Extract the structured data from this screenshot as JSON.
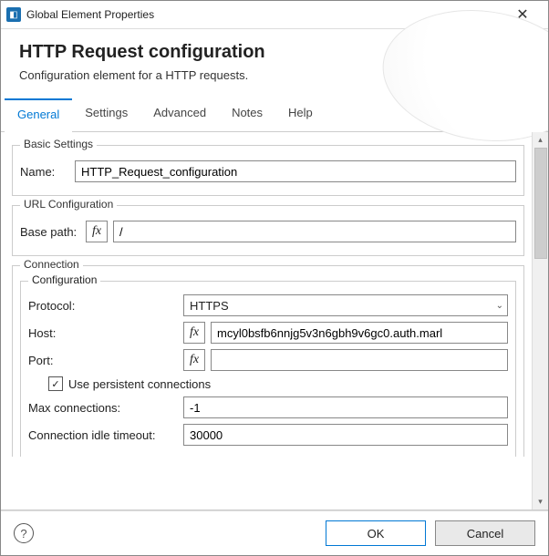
{
  "window": {
    "title": "Global Element Properties"
  },
  "header": {
    "title": "HTTP Request configuration",
    "desc": "Configuration element for a HTTP requests."
  },
  "tabs": {
    "general": "General",
    "settings": "Settings",
    "advanced": "Advanced",
    "notes": "Notes",
    "help": "Help"
  },
  "groups": {
    "basic": "Basic Settings",
    "url": "URL Configuration",
    "connection": "Connection",
    "config": "Configuration"
  },
  "labels": {
    "name": "Name:",
    "basepath": "Base path:",
    "protocol": "Protocol:",
    "host": "Host:",
    "port": "Port:",
    "persistent": "Use persistent connections",
    "maxconn": "Max connections:",
    "idle": "Connection idle timeout:"
  },
  "values": {
    "name": "HTTP_Request_configuration",
    "basepath": "/",
    "protocol": "HTTPS",
    "host": "mcyl0bsfb6nnjg5v3n6gbh9v6gc0.auth.marl",
    "port": "",
    "persistent": true,
    "maxconn": "-1",
    "idle": "30000"
  },
  "buttons": {
    "ok": "OK",
    "cancel": "Cancel",
    "help": "?"
  },
  "icons": {
    "fx": "fx",
    "check": "✓",
    "chev": "⌄"
  }
}
